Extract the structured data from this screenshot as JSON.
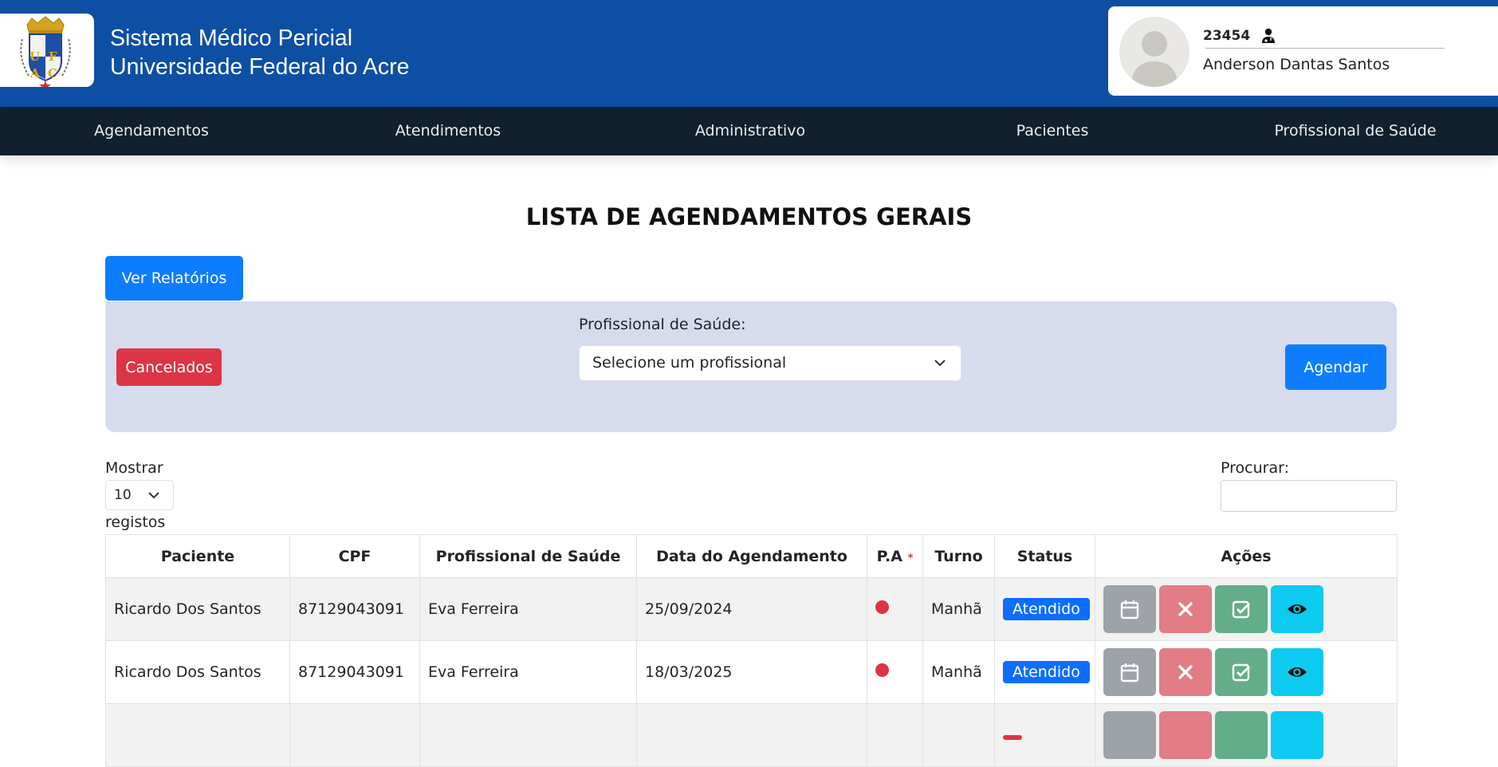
{
  "header": {
    "logo_letters": "UFAC",
    "title_line1": "Sistema Médico Pericial",
    "title_line2": "Universidade Federal do Acre"
  },
  "user": {
    "id": "23454",
    "name": "Anderson Dantas Santos",
    "role_icon": "doctor-icon"
  },
  "nav": {
    "items": [
      "Agendamentos",
      "Atendimentos",
      "Administrativo",
      "Pacientes",
      "Profissional de Saúde"
    ]
  },
  "page": {
    "title": "LISTA DE AGENDAMENTOS GERAIS",
    "report_button": "Ver Relatórios"
  },
  "filter": {
    "cancelled_button": "Cancelados",
    "professional_label": "Profissional de Saúde:",
    "professional_placeholder": "Selecione um profissional",
    "schedule_button": "Agendar"
  },
  "table_controls": {
    "show_label": "Mostrar",
    "page_length": "10",
    "records_label": "registos",
    "search_label": "Procurar:",
    "search_value": ""
  },
  "table": {
    "columns": [
      "Paciente",
      "CPF",
      "Profissional de Saúde",
      "Data do Agendamento",
      "P.A",
      "Turno",
      "Status",
      "Ações"
    ],
    "pa_marker": "*",
    "rows": [
      {
        "patient": "Ricardo Dos Santos",
        "cpf": "87129043091",
        "professional": "Eva Ferreira",
        "date": "25/09/2024",
        "shift": "Manhã",
        "status": "Atendido"
      },
      {
        "patient": "Ricardo Dos Santos",
        "cpf": "87129043091",
        "professional": "Eva Ferreira",
        "date": "18/03/2025",
        "shift": "Manhã",
        "status": "Atendido"
      },
      {
        "patient": "",
        "cpf": "",
        "professional": "",
        "date": "",
        "shift": "",
        "status": ""
      }
    ],
    "action_icons": [
      "calendar-icon",
      "close-icon",
      "check-square-icon",
      "eye-icon"
    ]
  },
  "colors": {
    "header_bg": "#0d4fa3",
    "nav_bg": "#10202f",
    "primary": "#0d7dfd",
    "danger": "#dc3545",
    "panel_bg": "#d6dcee"
  }
}
